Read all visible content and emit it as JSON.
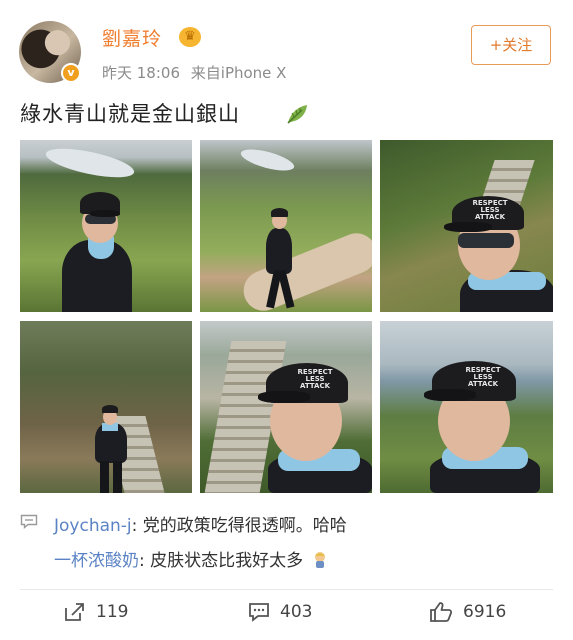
{
  "header": {
    "username": "劉嘉玲",
    "time": "昨天 18:06",
    "source": "来自iPhone X",
    "follow_label": "+关注"
  },
  "post": {
    "text": "綠水青山就是金山銀山"
  },
  "photos": {
    "cap_print": "RESPECT LESS ATTACK"
  },
  "comments": [
    {
      "author": "Joychan-j",
      "text": "党的政策吃得很透啊。哈哈"
    },
    {
      "author": "一杯浓酸奶",
      "text": "皮肤状态比我好太多"
    }
  ],
  "actions": {
    "repost_count": "119",
    "comment_count": "403",
    "like_count": "6916"
  },
  "colors": {
    "username": "#f07e2f",
    "comment_author": "#5b83c4",
    "follow_border": "#e89a58",
    "meta_text": "#8b8b8b"
  },
  "icons": [
    "crown-icon",
    "verified-badge-icon",
    "leaf-icon",
    "comment-bubble-icon",
    "repost-icon",
    "comment-icon",
    "like-icon",
    "emoji-icon"
  ]
}
